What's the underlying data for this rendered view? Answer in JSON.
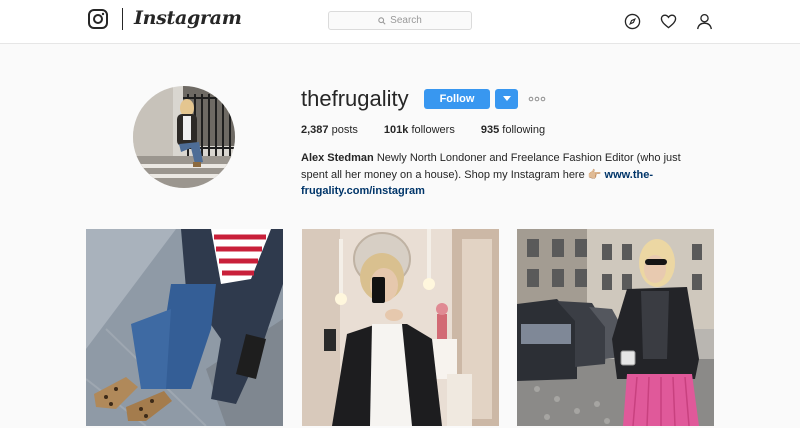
{
  "nav": {
    "wordmark": "Instagram",
    "search_placeholder": "Search",
    "icons": [
      "instagram-logo-icon",
      "search-icon",
      "compass-icon",
      "heart-icon",
      "person-icon"
    ]
  },
  "profile": {
    "username": "thefrugality",
    "follow_label": "Follow",
    "stats": {
      "posts_count": "2,387",
      "posts_label": "posts",
      "followers_count": "101k",
      "followers_label": "followers",
      "following_count": "935",
      "following_label": "following"
    },
    "bio": {
      "name": "Alex Stedman",
      "text": "Newly North Londoner and Freelance Fashion Editor (who just spent all her money on a house). Shop my Instagram here",
      "emoji": "👉🏼",
      "link": "www.the-frugality.com/instagram"
    }
  },
  "colors": {
    "accent": "#3897f0",
    "link": "#003569",
    "background": "#fafafa"
  }
}
